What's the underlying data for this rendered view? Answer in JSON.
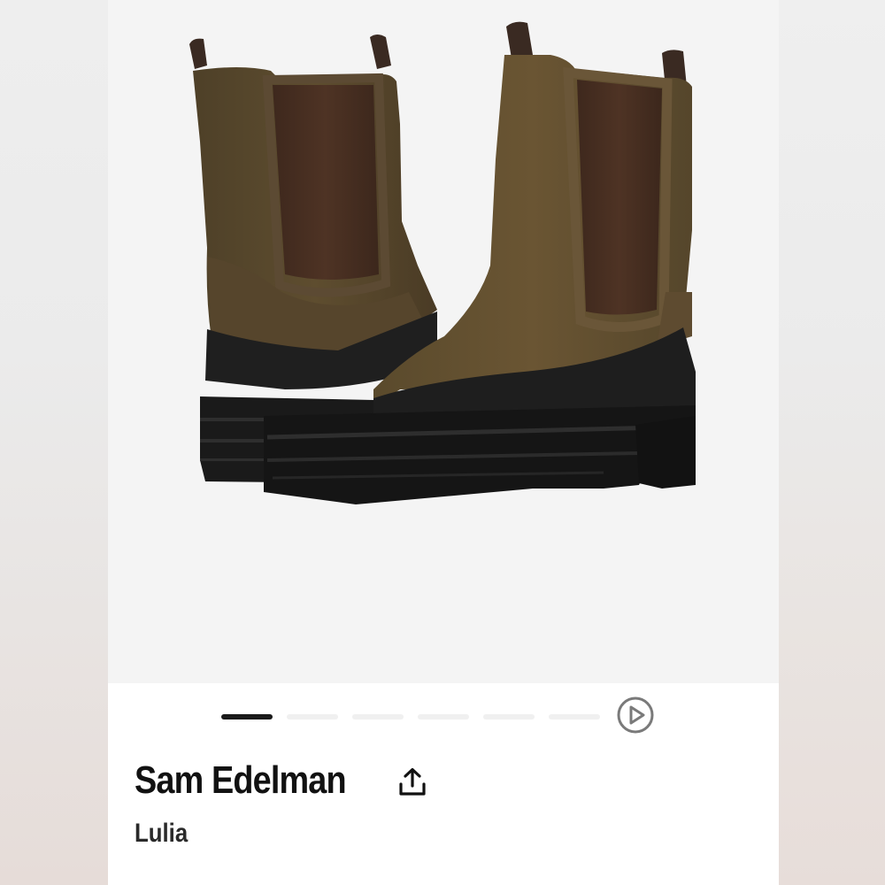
{
  "product": {
    "brand": "Sam Edelman",
    "name": "Lulia"
  },
  "gallery": {
    "image_description_icon": "boot-product-photo",
    "slide_count": 6,
    "active_slide": 1,
    "play_icon": "play-circle-icon"
  },
  "icons": {
    "share": "share-upload-icon"
  },
  "colors": {
    "card_bg": "#ffffff",
    "image_bg": "#f4f4f4",
    "active_dot": "#1a1a1a",
    "inactive_dot": "#f0f0f0",
    "text": "#111111",
    "boot_suede": "#5a4a2e",
    "boot_elastic": "#4a2f22",
    "sole": "#1c1c1c"
  }
}
